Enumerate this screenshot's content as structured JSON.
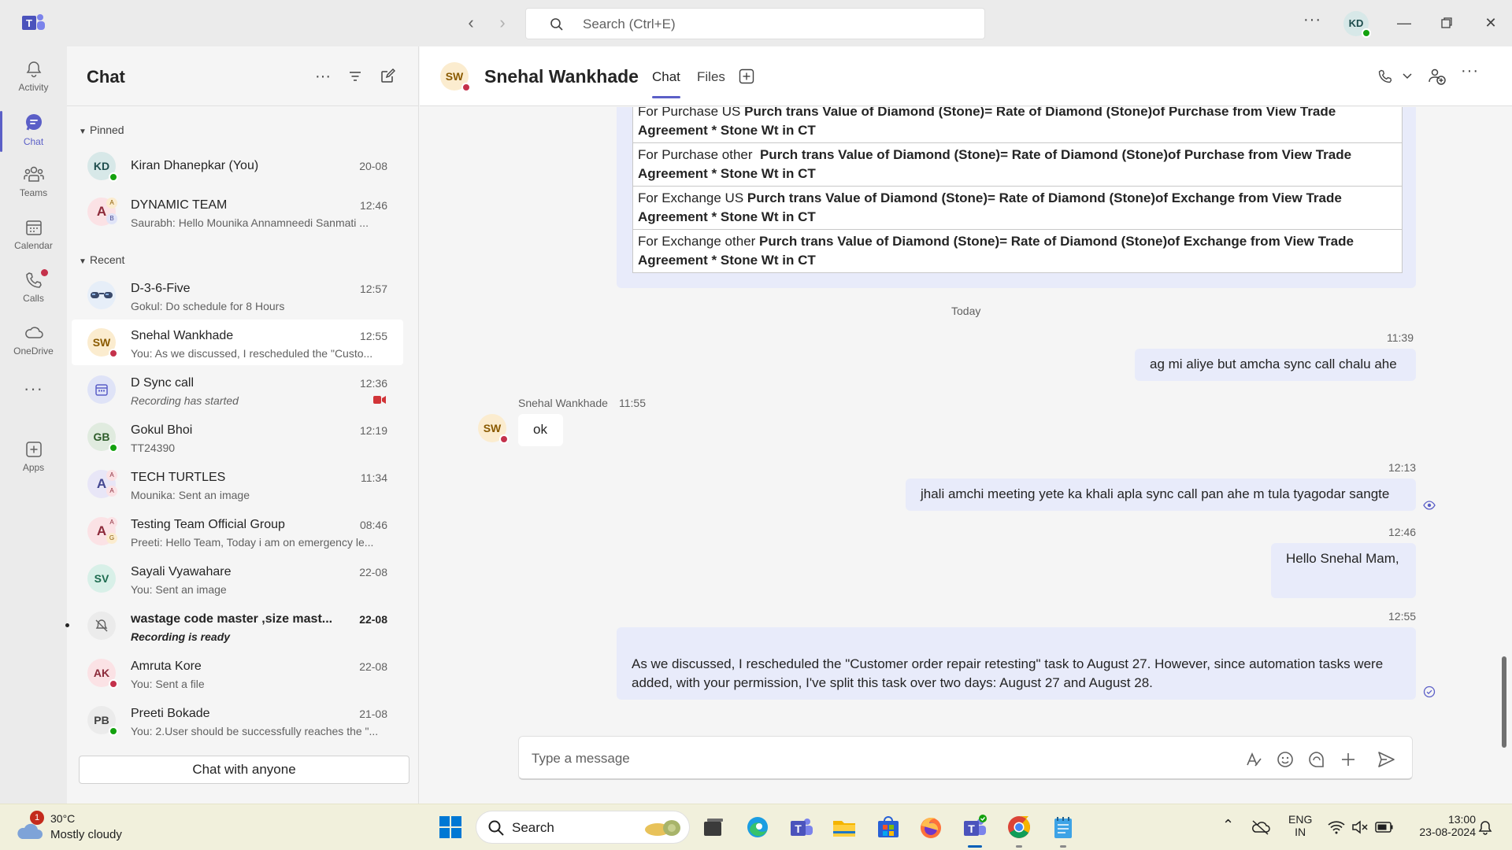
{
  "titlebar": {
    "search_placeholder": "Search (Ctrl+E)",
    "user_initials": "KD"
  },
  "rail": {
    "items": [
      {
        "label": "Activity",
        "icon": "bell-icon"
      },
      {
        "label": "Chat",
        "icon": "chat-icon"
      },
      {
        "label": "Teams",
        "icon": "teams-icon"
      },
      {
        "label": "Calendar",
        "icon": "calendar-icon"
      },
      {
        "label": "Calls",
        "icon": "phone-icon"
      },
      {
        "label": "OneDrive",
        "icon": "cloud-icon"
      },
      {
        "label": "Apps",
        "icon": "add-apps-icon"
      }
    ]
  },
  "chat_list": {
    "title": "Chat",
    "pinned_label": "Pinned",
    "recent_label": "Recent",
    "pinned": [
      {
        "initials": "KD",
        "name": "Kiran Dhanepkar (You)",
        "preview": "",
        "time": "20-08"
      },
      {
        "initials": "A",
        "name": "DYNAMIC TEAM",
        "preview": "Saurabh: Hello Mounika Annamneedi Sanmati ...",
        "time": "12:46"
      }
    ],
    "recent": [
      {
        "initials": "",
        "name": "D-3-6-Five",
        "preview": "Gokul: Do schedule for 8 Hours",
        "time": "12:57"
      },
      {
        "initials": "SW",
        "name": "Snehal Wankhade",
        "preview": "You: As we discussed, I rescheduled the \"Custo...",
        "time": "12:55"
      },
      {
        "initials": "",
        "name": "D Sync call",
        "preview": "Recording has started",
        "time": "12:36"
      },
      {
        "initials": "GB",
        "name": "Gokul Bhoi",
        "preview": "TT24390",
        "time": "12:19"
      },
      {
        "initials": "A",
        "name": "TECH TURTLES",
        "preview": "Mounika: Sent an image",
        "time": "11:34"
      },
      {
        "initials": "A",
        "name": "Testing Team Official Group",
        "preview": "Preeti: Hello Team, Today i am on emergency le...",
        "time": "08:46"
      },
      {
        "initials": "SV",
        "name": "Sayali Vyawahare",
        "preview": "You: Sent an image",
        "time": "22-08"
      },
      {
        "initials": "",
        "name": "wastage code master ,size mast...",
        "preview": "Recording is ready",
        "time": "22-08"
      },
      {
        "initials": "AK",
        "name": "Amruta Kore",
        "preview": "You: Sent a file",
        "time": "22-08"
      },
      {
        "initials": "PB",
        "name": "Preeti Bokade",
        "preview": "You: 2.User should be successfully reaches the \"...",
        "time": "21-08"
      }
    ],
    "chat_with_anyone": "Chat with anyone"
  },
  "conversation": {
    "initials": "SW",
    "name": "Snehal Wankhade",
    "tabs": [
      "Chat",
      "Files"
    ],
    "rules": [
      {
        "label": "For Purchase US ",
        "formula": "Purch trans Value of Diamond (Stone)= Rate of Diamond (Stone)of Purchase from View Trade Agreement * Stone Wt in CT"
      },
      {
        "label": "For Purchase other  ",
        "formula": "Purch trans Value of Diamond (Stone)= Rate of Diamond (Stone)of Purchase from View Trade Agreement * Stone Wt in CT"
      },
      {
        "label": "For Exchange US ",
        "formula": "Purch trans Value of Diamond (Stone)= Rate of Diamond (Stone)of Exchange from View Trade Agreement * Stone Wt in CT"
      },
      {
        "label": "For Exchange other ",
        "formula": "Purch trans Value of Diamond (Stone)= Rate of Diamond (Stone)of Exchange from View Trade Agreement * Stone Wt in CT"
      }
    ],
    "day_separator": "Today",
    "messages": [
      {
        "time": "11:39",
        "text": "ag mi aliye but amcha sync call chalu ahe"
      },
      {
        "sender": "Snehal Wankhade",
        "time": "11:55",
        "text": "ok"
      },
      {
        "time": "12:13",
        "text": "jhali amchi meeting yete ka khali apla sync call pan ahe m tula tyagodar sangte"
      },
      {
        "time": "12:46",
        "text": "Hello Snehal Mam,"
      },
      {
        "time": "12:55",
        "text": "As we discussed, I rescheduled the \"Customer order repair retesting\" task to August 27. However, since automation tasks were added, with your permission, I've split this task over two days: August 27 and August 28."
      }
    ],
    "compose_placeholder": "Type a message"
  },
  "taskbar": {
    "weather_temp": "30°C",
    "weather_cond": "Mostly cloudy",
    "weather_badge": "1",
    "search_label": "Search",
    "lang_top": "ENG",
    "lang_bottom": "IN",
    "clock_time": "13:00",
    "clock_date": "23-08-2024"
  },
  "colors": {
    "accent": "#5b5fc7",
    "outgoing_bubble": "#e8ebfa",
    "presence_available": "#13a10e",
    "presence_busy": "#c4314b"
  }
}
